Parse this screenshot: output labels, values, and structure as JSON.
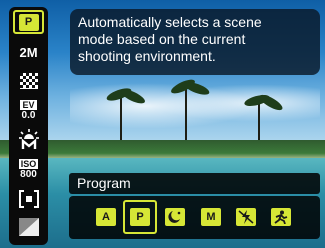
{
  "tooltip": {
    "text_line1": "Automatically selects a scene",
    "text_line2": "mode based on the current",
    "text_line3": "shooting environment."
  },
  "mode_bar": {
    "label": "Program"
  },
  "sidebar": {
    "items": [
      {
        "name": "scene-mode",
        "glyph": "P",
        "selected": true
      },
      {
        "name": "resolution",
        "glyph": "2M",
        "selected": false
      },
      {
        "name": "quality",
        "glyph": "",
        "selected": false
      },
      {
        "name": "exposure",
        "glyph_top": "EV",
        "glyph_bottom": "0.0",
        "selected": false
      },
      {
        "name": "white-balance",
        "glyph": "",
        "selected": false
      },
      {
        "name": "iso",
        "glyph_top": "ISO",
        "glyph_bottom": "800",
        "selected": false
      },
      {
        "name": "metering",
        "glyph": "",
        "selected": false
      },
      {
        "name": "color-effect",
        "glyph": "",
        "selected": false
      }
    ]
  },
  "strip": {
    "items": [
      {
        "name": "auto",
        "glyph": "A",
        "selected": false
      },
      {
        "name": "program",
        "glyph": "P",
        "selected": true
      },
      {
        "name": "night-portrait",
        "glyph": "",
        "selected": false
      },
      {
        "name": "manual",
        "glyph": "M",
        "selected": false
      },
      {
        "name": "no-flash",
        "glyph": "",
        "selected": false
      },
      {
        "name": "sports",
        "glyph": "",
        "selected": false
      }
    ]
  },
  "colors": {
    "accent": "#d6e636",
    "panel": "#0a0a0a"
  }
}
